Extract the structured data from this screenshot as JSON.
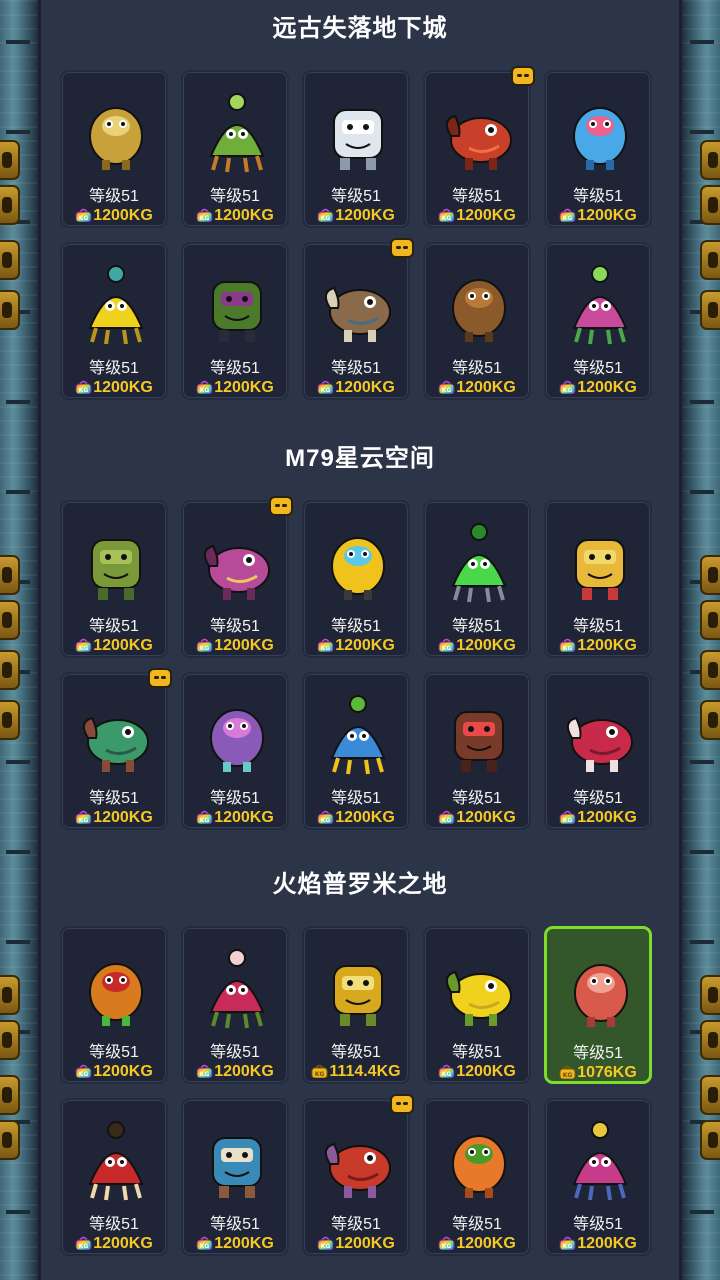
{
  "colors": {
    "background": "#2c3448",
    "card": "#1f2536",
    "price": "#f6c824",
    "selected_border": "#7fdc2a",
    "badge": "#f2b61e"
  },
  "sections": [
    {
      "title": "远古失落地下城",
      "items": [
        {
          "name": "card-king-scarecrow",
          "icon": "king-scarecrow-icon",
          "level": "等级51",
          "price": "1200KG",
          "bag": "rainbow",
          "badge": false,
          "selected": false
        },
        {
          "name": "card-sprout",
          "icon": "sprout-creature-icon",
          "level": "等级51",
          "price": "1200KG",
          "bag": "rainbow",
          "badge": false,
          "selected": false
        },
        {
          "name": "card-yeti",
          "icon": "yeti-icon",
          "level": "等级51",
          "price": "1200KG",
          "bag": "rainbow",
          "badge": false,
          "selected": false
        },
        {
          "name": "card-red-dinosaur",
          "icon": "red-dinosaur-icon",
          "level": "等级51",
          "price": "1200KG",
          "bag": "rainbow",
          "badge": true,
          "selected": false
        },
        {
          "name": "card-blue-slime",
          "icon": "blue-slime-icon",
          "level": "等级51",
          "price": "1200KG",
          "bag": "rainbow",
          "badge": false,
          "selected": false
        },
        {
          "name": "card-yellow-squirrel",
          "icon": "yellow-squirrel-icon",
          "level": "等级51",
          "price": "1200KG",
          "bag": "rainbow",
          "badge": false,
          "selected": false
        },
        {
          "name": "card-top-hat-goblin",
          "icon": "top-hat-goblin-icon",
          "level": "等级51",
          "price": "1200KG",
          "bag": "rainbow",
          "badge": false,
          "selected": false
        },
        {
          "name": "card-shell-mech",
          "icon": "shell-mech-icon",
          "level": "等级51",
          "price": "1200KG",
          "bag": "rainbow",
          "badge": true,
          "selected": false
        },
        {
          "name": "card-brown-bear",
          "icon": "brown-bear-icon",
          "level": "等级51",
          "price": "1200KG",
          "bag": "rainbow",
          "badge": false,
          "selected": false
        },
        {
          "name": "card-pink-croc",
          "icon": "pink-croc-icon",
          "level": "等级51",
          "price": "1200KG",
          "bag": "rainbow",
          "badge": false,
          "selected": false
        }
      ]
    },
    {
      "title": "M79星云空间",
      "items": [
        {
          "name": "card-green-pod",
          "icon": "green-pod-icon",
          "level": "等级51",
          "price": "1200KG",
          "bag": "rainbow",
          "badge": false,
          "selected": false
        },
        {
          "name": "card-pink-pot",
          "icon": "pink-pot-icon",
          "level": "等级51",
          "price": "1200KG",
          "bag": "rainbow",
          "badge": true,
          "selected": false
        },
        {
          "name": "card-bee",
          "icon": "bee-icon",
          "level": "等级51",
          "price": "1200KG",
          "bag": "rainbow",
          "badge": false,
          "selected": false
        },
        {
          "name": "card-green-robot",
          "icon": "green-robot-icon",
          "level": "等级51",
          "price": "1200KG",
          "bag": "rainbow",
          "badge": false,
          "selected": false
        },
        {
          "name": "card-cone-creature",
          "icon": "cone-creature-icon",
          "level": "等级51",
          "price": "1200KG",
          "bag": "rainbow",
          "badge": false,
          "selected": false
        },
        {
          "name": "card-frankenstein-turtle",
          "icon": "frankenstein-turtle-icon",
          "level": "等级51",
          "price": "1200KG",
          "bag": "rainbow",
          "badge": true,
          "selected": false
        },
        {
          "name": "card-bulb-octopus",
          "icon": "bulb-octopus-icon",
          "level": "等级51",
          "price": "1200KG",
          "bag": "rainbow",
          "badge": false,
          "selected": false
        },
        {
          "name": "card-beetle",
          "icon": "beetle-icon",
          "level": "等级51",
          "price": "1200KG",
          "bag": "rainbow",
          "badge": false,
          "selected": false
        },
        {
          "name": "card-chocolate-blob",
          "icon": "chocolate-blob-icon",
          "level": "等级51",
          "price": "1200KG",
          "bag": "rainbow",
          "badge": false,
          "selected": false
        },
        {
          "name": "card-red-urchin",
          "icon": "red-urchin-icon",
          "level": "等级51",
          "price": "1200KG",
          "bag": "rainbow",
          "badge": false,
          "selected": false
        }
      ]
    },
    {
      "title": "火焰普罗米之地",
      "items": [
        {
          "name": "card-toucan",
          "icon": "toucan-icon",
          "level": "等级51",
          "price": "1200KG",
          "bag": "rainbow",
          "badge": false,
          "selected": false
        },
        {
          "name": "card-flytrap",
          "icon": "flytrap-icon",
          "level": "等级51",
          "price": "1200KG",
          "bag": "rainbow",
          "badge": false,
          "selected": false
        },
        {
          "name": "card-pineapple-owl",
          "icon": "pineapple-owl-icon",
          "level": "等级51",
          "price": "1114.4KG",
          "bag": "gold",
          "badge": false,
          "selected": false
        },
        {
          "name": "card-banana",
          "icon": "banana-creature-icon",
          "level": "等级51",
          "price": "1200KG",
          "bag": "rainbow",
          "badge": false,
          "selected": false
        },
        {
          "name": "card-sausage-octopus",
          "icon": "sausage-octopus-icon",
          "level": "等级51",
          "price": "1076KG",
          "bag": "gold",
          "badge": false,
          "selected": true
        },
        {
          "name": "card-apple-halves",
          "icon": "apple-halves-icon",
          "level": "等级51",
          "price": "1200KG",
          "bag": "rainbow",
          "badge": false,
          "selected": false
        },
        {
          "name": "card-blue-druid",
          "icon": "blue-druid-icon",
          "level": "等级51",
          "price": "1200KG",
          "bag": "rainbow",
          "badge": false,
          "selected": false
        },
        {
          "name": "card-cube-squid",
          "icon": "cube-squid-icon",
          "level": "等级51",
          "price": "1200KG",
          "bag": "rainbow",
          "badge": true,
          "selected": false
        },
        {
          "name": "card-orange-hamster",
          "icon": "orange-hamster-icon",
          "level": "等级51",
          "price": "1200KG",
          "bag": "rainbow",
          "badge": false,
          "selected": false
        },
        {
          "name": "card-rocket-robot",
          "icon": "rocket-robot-icon",
          "level": "等级51",
          "price": "1200KG",
          "bag": "rainbow",
          "badge": false,
          "selected": false
        }
      ]
    }
  ]
}
